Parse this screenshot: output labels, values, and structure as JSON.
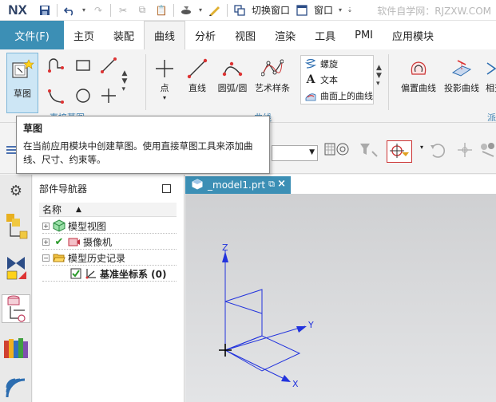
{
  "app": {
    "logo": "NX",
    "watermark": "软件自学网：RJZXW.COM"
  },
  "quick_access": {
    "switch_window_label": "切换窗口",
    "window_label": "窗口"
  },
  "tabs": [
    {
      "label": "文件(F)"
    },
    {
      "label": "主页"
    },
    {
      "label": "装配"
    },
    {
      "label": "曲线"
    },
    {
      "label": "分析"
    },
    {
      "label": "视图"
    },
    {
      "label": "渲染"
    },
    {
      "label": "工具"
    },
    {
      "label": "PMI"
    },
    {
      "label": "应用模块"
    }
  ],
  "ribbon": {
    "sketch_label": "草图",
    "point_label": "点",
    "line_label": "直线",
    "arc_label": "圆弧/圆",
    "art_spline_label": "艺术样条",
    "helix_label": "螺旋",
    "text_label": "文本",
    "curve_on_surface_label": "曲面上的曲线",
    "offset_curve_label": "偏置曲线",
    "project_curve_label": "投影曲线",
    "cut_off_label": "相交",
    "group_direct_sketch": "直接草图",
    "group_curve": "曲线",
    "group_derived": "派"
  },
  "tooltip": {
    "title": "草图",
    "body": "在当前应用模块中创建草图。使用直接草图工具来添加曲线、尺寸、约束等。"
  },
  "navigator": {
    "title": "部件导航器",
    "column_name": "名称",
    "items": [
      {
        "label": "模型视图"
      },
      {
        "label": "摄像机"
      },
      {
        "label": "模型历史记录"
      },
      {
        "label": "基准坐标系 (0)"
      }
    ]
  },
  "graphics": {
    "tab_label": "_model1.prt",
    "axis_x": "X",
    "axis_y": "Y",
    "axis_z": "Z"
  }
}
